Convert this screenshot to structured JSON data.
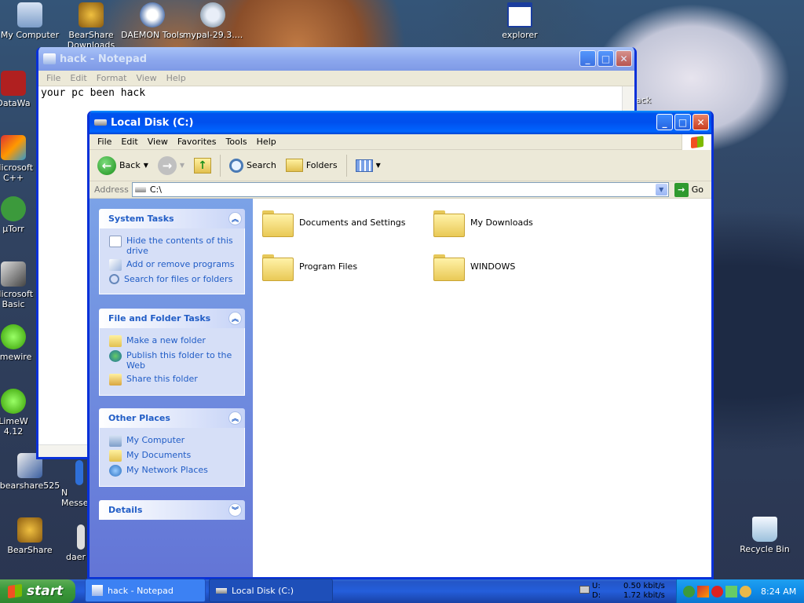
{
  "desktop": {
    "icons": [
      {
        "label": "My Computer",
        "icon": "my-computer-icon"
      },
      {
        "label": "BearShare Downloads",
        "icon": "bearshare-downloads-icon"
      },
      {
        "label": "DAEMON Tools",
        "icon": "daemon-tools-icon"
      },
      {
        "label": "mypal-29.3....",
        "icon": "mypal-icon"
      },
      {
        "label": "explorer",
        "icon": "explorer-window-icon"
      },
      {
        "label": "DataWa",
        "icon": "datawa-icon"
      },
      {
        "label": "Microsoft C++",
        "icon": "microsoft-cpp-icon"
      },
      {
        "label": "µTorr",
        "icon": "utorrent-icon"
      },
      {
        "label": "Microsoft Basic",
        "icon": "microsoft-basic-icon"
      },
      {
        "label": "limewire",
        "icon": "limewire-icon"
      },
      {
        "label": "LimeW 4.12",
        "icon": "limewire-412-icon"
      },
      {
        "label": "bearshare525",
        "icon": "bearshare525-icon"
      },
      {
        "label": "N Messe",
        "icon": "messenger-icon"
      },
      {
        "label": "BearShare",
        "icon": "bearshare-icon"
      },
      {
        "label": "daer",
        "icon": "daemon-icon"
      },
      {
        "label": "ack",
        "icon": "partial-icon"
      },
      {
        "label": "Recycle Bin",
        "icon": "recycle-bin-icon"
      }
    ]
  },
  "notepad": {
    "title": "hack - Notepad",
    "menu": [
      "File",
      "Edit",
      "Format",
      "View",
      "Help"
    ],
    "text": "your pc been hack"
  },
  "explorer": {
    "title": "Local Disk (C:)",
    "menu": [
      "File",
      "Edit",
      "View",
      "Favorites",
      "Tools",
      "Help"
    ],
    "toolbar": {
      "back": "Back",
      "search": "Search",
      "folders": "Folders"
    },
    "address": {
      "label": "Address",
      "value": "C:\\",
      "go": "Go"
    },
    "panels": [
      {
        "title": "System Tasks",
        "items": [
          {
            "label": "Hide the contents of this drive",
            "icon": "hide-drive-icon"
          },
          {
            "label": "Add or remove programs",
            "icon": "add-remove-programs-icon"
          },
          {
            "label": "Search for files or folders",
            "icon": "search-files-icon"
          }
        ]
      },
      {
        "title": "File and Folder Tasks",
        "items": [
          {
            "label": "Make a new folder",
            "icon": "new-folder-icon"
          },
          {
            "label": "Publish this folder to the Web",
            "icon": "publish-web-icon"
          },
          {
            "label": "Share this folder",
            "icon": "share-folder-icon"
          }
        ]
      },
      {
        "title": "Other Places",
        "items": [
          {
            "label": "My Computer",
            "icon": "my-computer-icon"
          },
          {
            "label": "My Documents",
            "icon": "my-documents-icon"
          },
          {
            "label": "My Network Places",
            "icon": "network-places-icon"
          }
        ]
      },
      {
        "title": "Details",
        "items": []
      }
    ],
    "folders": [
      "Documents and Settings",
      "My Downloads",
      "Program Files",
      "WINDOWS"
    ]
  },
  "taskbar": {
    "start": "start",
    "tasks": [
      "hack - Notepad",
      "Local Disk (C:)"
    ],
    "net": {
      "up_label": "U:",
      "down_label": "D:",
      "up": "0.50 kbit/s",
      "down": "1.72 kbit/s"
    },
    "clock": "8:24 AM"
  },
  "colors": {
    "xp_blue": "#0054e3",
    "start_green": "#3c9a3c",
    "task_blue": "#245edb",
    "tray_blue": "#0f8ce9"
  }
}
